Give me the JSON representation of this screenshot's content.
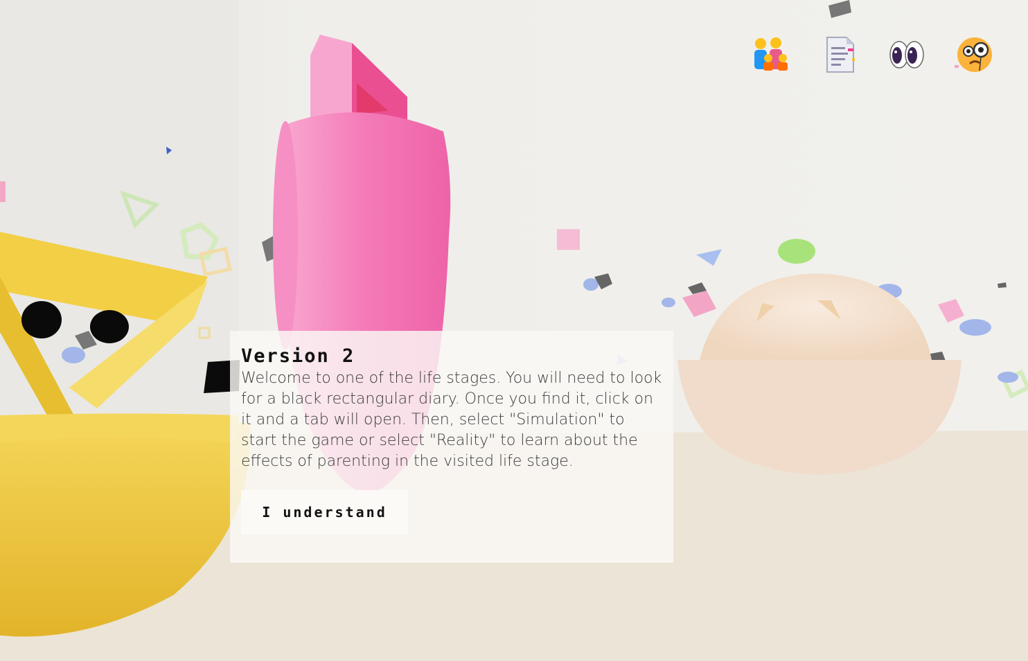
{
  "toolbar": {
    "icons": [
      {
        "name": "family-icon"
      },
      {
        "name": "document-icon"
      },
      {
        "name": "eyes-icon"
      },
      {
        "name": "face-with-monocle-icon"
      }
    ]
  },
  "dialog": {
    "title": "Version 2",
    "body": "Welcome to one of the life stages. You will need to look for a black rectangular diary. Once you find it, click on it and a tab will open. Then, select \"Simulation\" to start the game or select \"Reality\" to learn about the effects of parenting in the visited life stage.",
    "button_label": "I understand"
  },
  "colors": {
    "background": "#efeeea",
    "floor": "#ece4d6",
    "yellow_character": "#f0c93c",
    "pink_character": "#f47ab8",
    "cream_dome": "#f3dfcc",
    "dialog_bg": "#faf9f5"
  }
}
